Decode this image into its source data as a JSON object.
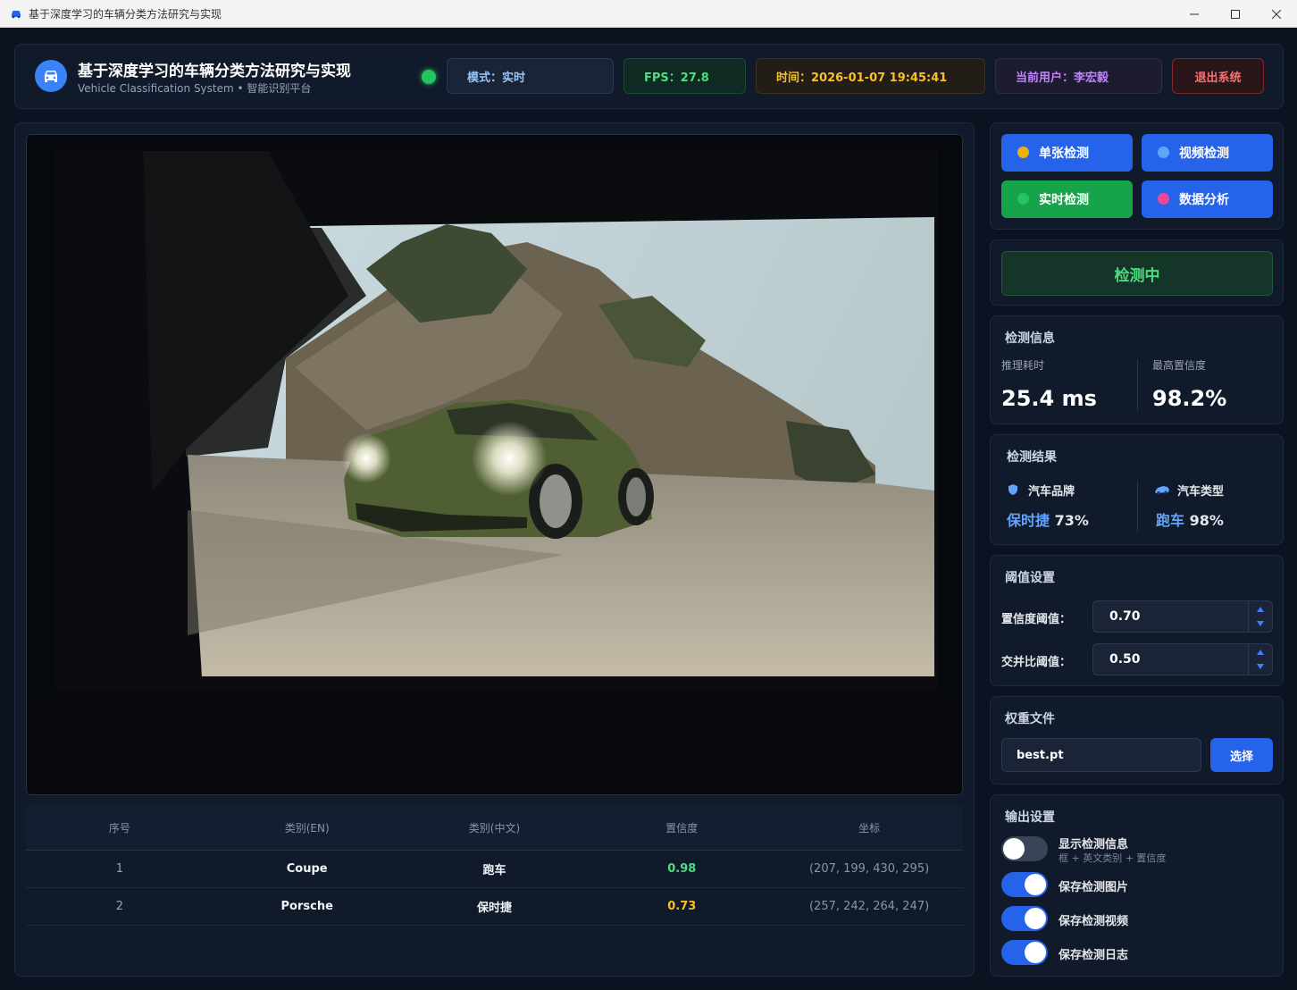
{
  "window": {
    "title": "基于深度学习的车辆分类方法研究与实现",
    "minimize_icon": "minimize-icon",
    "maximize_icon": "maximize-icon",
    "close_icon": "close-icon"
  },
  "header": {
    "title": "基于深度学习的车辆分类方法研究与实现",
    "subtitle": "Vehicle Classification System • 智能识别平台",
    "mode": "模式：实时",
    "fps": "FPS：27.8",
    "time": "时间：2026-01-07 19:45:41",
    "user": "当前用户：李宏毅",
    "logout_label": "退出系统",
    "status_color": "#22c55e"
  },
  "modes": {
    "single": {
      "label": "单张检测",
      "dot_color": "#eab308"
    },
    "video": {
      "label": "视频检测",
      "dot_color": "#60a5fa"
    },
    "realtime": {
      "label": "实时检测",
      "dot_color": "#22c55e"
    },
    "analysis": {
      "label": "数据分析",
      "dot_color": "#ec4899"
    }
  },
  "detect_status": "检测中",
  "info": {
    "title": "检测信息",
    "inference_label": "推理耗时",
    "inference_value": "25.4 ms",
    "confidence_label": "最高置信度",
    "confidence_value": "98.2%"
  },
  "result": {
    "title": "检测结果",
    "brand_label": "汽车品牌",
    "brand_name": "保时捷",
    "brand_conf": "73%",
    "type_label": "汽车类型",
    "type_name": "跑车",
    "type_conf": "98%"
  },
  "threshold": {
    "title": "阈值设置",
    "conf_label": "置信度阈值：",
    "conf_value": "0.70",
    "iou_label": "交并比阈值：",
    "iou_value": "0.50"
  },
  "weights": {
    "title": "权重文件",
    "file": "best.pt",
    "select_label": "选择"
  },
  "output": {
    "title": "输出设置",
    "show_info": {
      "label": "显示检测信息",
      "sub": "框 + 英文类别 + 置信度",
      "on": false
    },
    "save_image": {
      "label": "保存检测图片",
      "on": true
    },
    "save_video": {
      "label": "保存检测视频",
      "on": true
    },
    "save_log": {
      "label": "保存检测日志",
      "on": true
    }
  },
  "table": {
    "headers": [
      "序号",
      "类别(EN)",
      "类别(中文)",
      "置信度",
      "坐标"
    ],
    "rows": [
      {
        "idx": "1",
        "en": "Coupe",
        "cn": "跑车",
        "conf": "0.98",
        "coords": "(207, 199, 430, 295)",
        "conf_color": "#4ade80"
      },
      {
        "idx": "2",
        "en": "Porsche",
        "cn": "保时捷",
        "conf": "0.73",
        "coords": "(257, 242, 264, 247)",
        "conf_color": "#fbbf24"
      }
    ]
  },
  "viewer": {
    "image_subject": "green-sports-car-photo"
  }
}
